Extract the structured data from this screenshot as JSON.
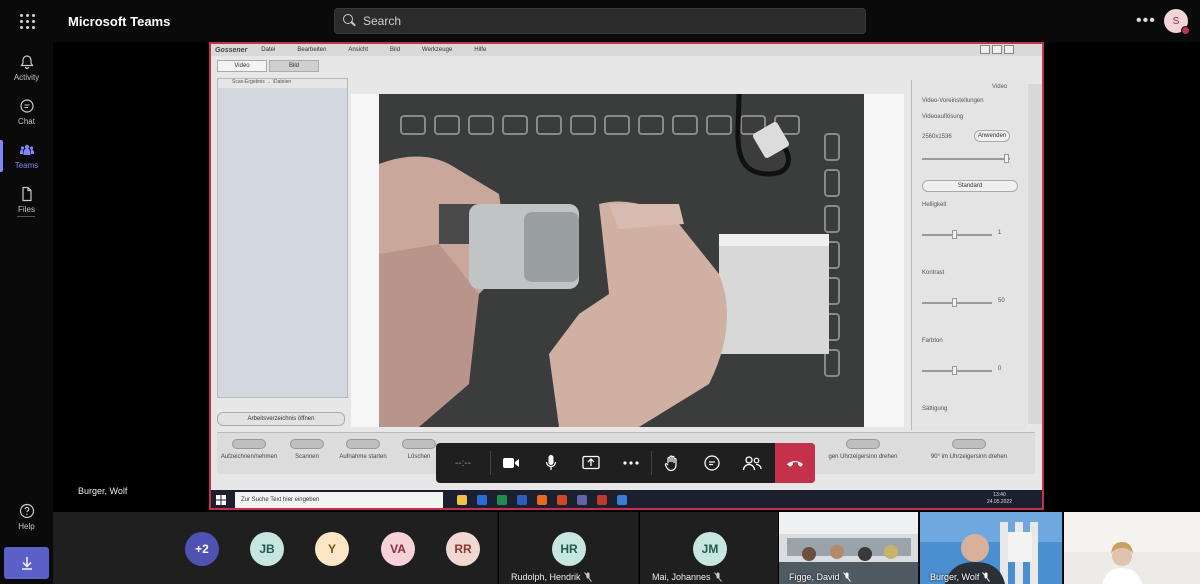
{
  "app": {
    "title": "Microsoft Teams"
  },
  "search": {
    "label": "Search"
  },
  "user": {
    "avatar_initial": "S"
  },
  "rail": {
    "items": [
      {
        "label": "Activity",
        "icon": "bell-icon"
      },
      {
        "label": "Chat",
        "icon": "chat-icon"
      },
      {
        "label": "Teams",
        "icon": "teams-icon"
      },
      {
        "label": "Files",
        "icon": "file-icon"
      }
    ],
    "help": {
      "label": "Help"
    }
  },
  "stage": {
    "presenter_name": "Burger, Wolf"
  },
  "shared_app": {
    "menu": [
      "Datei",
      "Bearbeiten",
      "Ansicht",
      "Bild",
      "Werkzeuge",
      "Hilfe"
    ],
    "tabs": [
      "Video",
      "Bild"
    ],
    "left_panel_header": "Scan-Ergebnis → \\Dateien",
    "left_panel_button": "Arbeitsverzeichnis öffnen",
    "right_panel": {
      "title": "Video",
      "settings_heading": "Video-Voreinstellungen",
      "resolution_label": "Videoauflösung",
      "resolution_value": "2560x1536",
      "apply_button": "Anwenden",
      "standard_button": "Standard",
      "brightness_label": "Helligkeit",
      "brightness_value": "1",
      "contrast_label": "Kontrast",
      "contrast_value": "50",
      "color_label": "Farbton",
      "color_value": "0",
      "saturation_label": "Sättigung"
    },
    "tools": [
      "Aufzeichnen/nehmen",
      "Scannen",
      "Aufnahme starten",
      "Löschen",
      "gen Uhrzeigersinn drehen",
      "90° im Uhrzeigersinn drehen"
    ],
    "taskbar": {
      "search_placeholder": "Zur Suche Text hier eingeben",
      "time": "13:40",
      "date": "24.05.2022",
      "lang": "DEU"
    }
  },
  "controls": {
    "timer": "--:--",
    "buttons": [
      "camera",
      "mic",
      "share",
      "more",
      "raise-hand",
      "chat",
      "people",
      "leave"
    ]
  },
  "gallery": {
    "overflow": [
      {
        "label": "+2",
        "bg": "#4f52b2",
        "fg": "#ffffff"
      },
      {
        "label": "JB",
        "bg": "#c8e6e0",
        "fg": "#205c52"
      },
      {
        "label": "Y",
        "bg": "#fbe7c6",
        "fg": "#7a5217"
      },
      {
        "label": "VA",
        "bg": "#f6d1d8",
        "fg": "#8b2c44"
      },
      {
        "label": "RR",
        "bg": "#f2d8d2",
        "fg": "#8b3b2c"
      }
    ],
    "participants": [
      {
        "initials": "HR",
        "name": "Rudolph, Hendrik"
      },
      {
        "initials": "JM",
        "name": "Mai, Johannes"
      }
    ],
    "video_participants": [
      {
        "name": "Figge, David"
      },
      {
        "name": "Burger, Wolf"
      },
      {
        "name": ""
      }
    ]
  },
  "colors": {
    "accent": "#5b5fc7",
    "leave": "#c4314b",
    "share_border": "#c4314b"
  }
}
